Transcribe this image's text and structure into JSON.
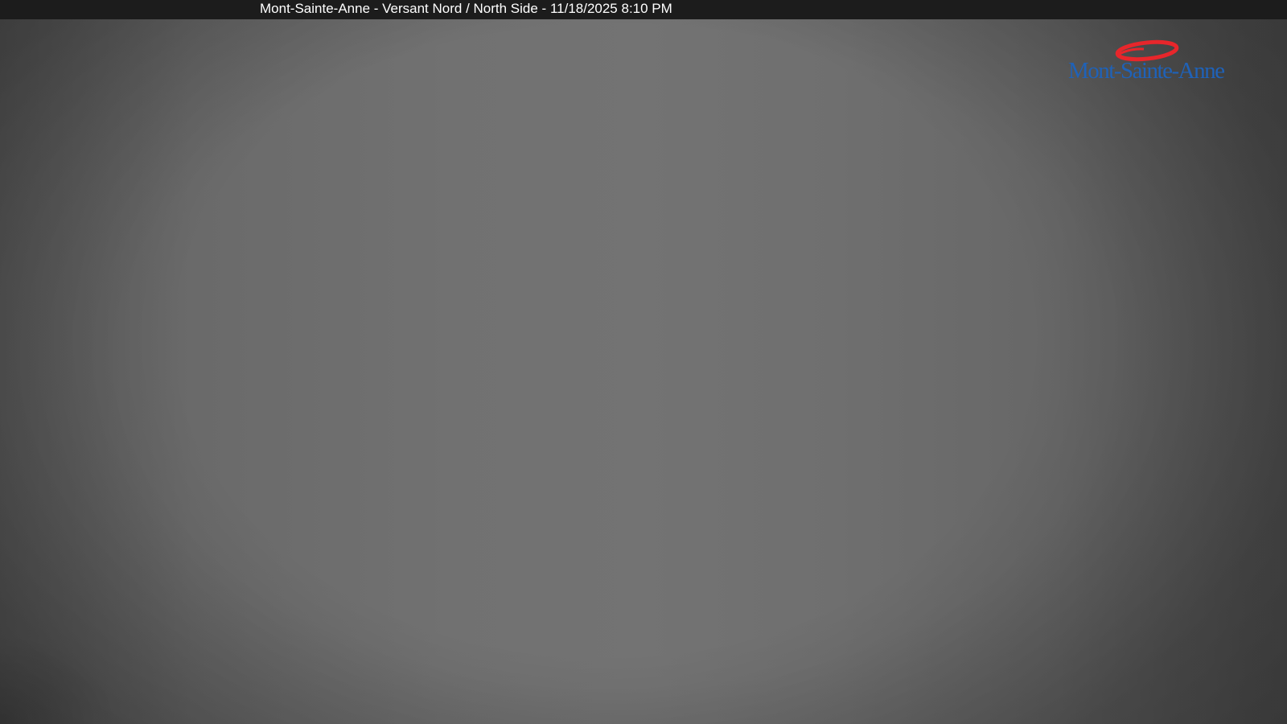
{
  "caption": {
    "title": "Mont-Sainte-Anne - Versant Nord / North Side - 11/18/2025 8:10 PM"
  },
  "logo": {
    "text": "Mont-Sainte-Anne",
    "icon": "red-ellipse-swoosh-icon",
    "text_color": "#1f62b8",
    "accent_color": "#e8262b"
  },
  "colors": {
    "title_bar": "#1c1c1c",
    "title_text": "#ffffff",
    "scene": "#6e6e6e"
  }
}
